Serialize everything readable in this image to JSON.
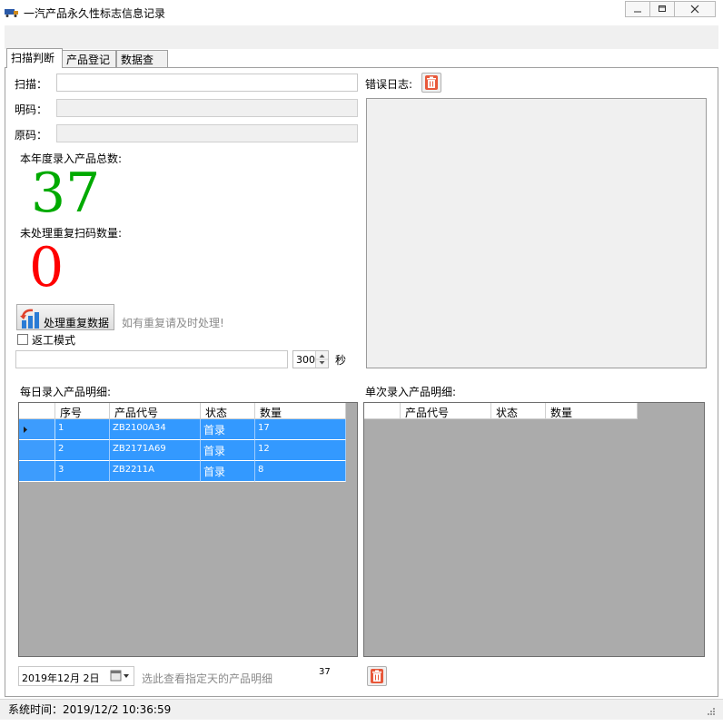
{
  "window": {
    "title": "一汽产品永久性标志信息记录",
    "minimize_icon": "minimize-icon",
    "maximize_icon": "maximize-icon",
    "close_icon": "close-icon"
  },
  "tabs": [
    {
      "label": "扫描判断",
      "active": true
    },
    {
      "label": "产品登记",
      "active": false
    },
    {
      "label": "数据查询",
      "active": false
    }
  ],
  "scan": {
    "scan_label": "扫描：",
    "scan_value": "",
    "plain_label": "明码：",
    "plain_value": "",
    "raw_label": "原码：",
    "raw_value": ""
  },
  "stats": {
    "year_total_label": "本年度录入产品总数:",
    "year_total_value": "37",
    "year_total_color": "#00aa00",
    "dup_label": "未处理重复扫码数量:",
    "dup_value": "0",
    "dup_color": "#ff0000"
  },
  "actions": {
    "process_button": "处理重复数据",
    "process_hint": "如有重复请及时处理!",
    "rework_label": "返工模式",
    "rework_checked": false,
    "seconds_value": "300",
    "seconds_unit": "秒"
  },
  "error_log": {
    "label": "错误日志:",
    "clear_icon": "trash-icon"
  },
  "daily_grid": {
    "title": "每日录入产品明细:",
    "columns": [
      "序号",
      "产品代号",
      "状态",
      "数量"
    ],
    "rows": [
      [
        "1",
        "ZB2100A34",
        "首录",
        "17"
      ],
      [
        "2",
        "ZB2171A69",
        "首录",
        "12"
      ],
      [
        "3",
        "ZB2211A",
        "首录",
        "8"
      ]
    ],
    "selection_color": "#3399ff"
  },
  "single_grid": {
    "title": "单次录入产品明细:",
    "columns": [
      "产品代号",
      "状态",
      "数量"
    ]
  },
  "footer": {
    "date_value": "2019年12月  2日",
    "date_hint": "选此查看指定天的产品明细",
    "count_value": "37"
  },
  "status_bar": {
    "text": "系统时间：2019/12/2 10:36:59"
  }
}
